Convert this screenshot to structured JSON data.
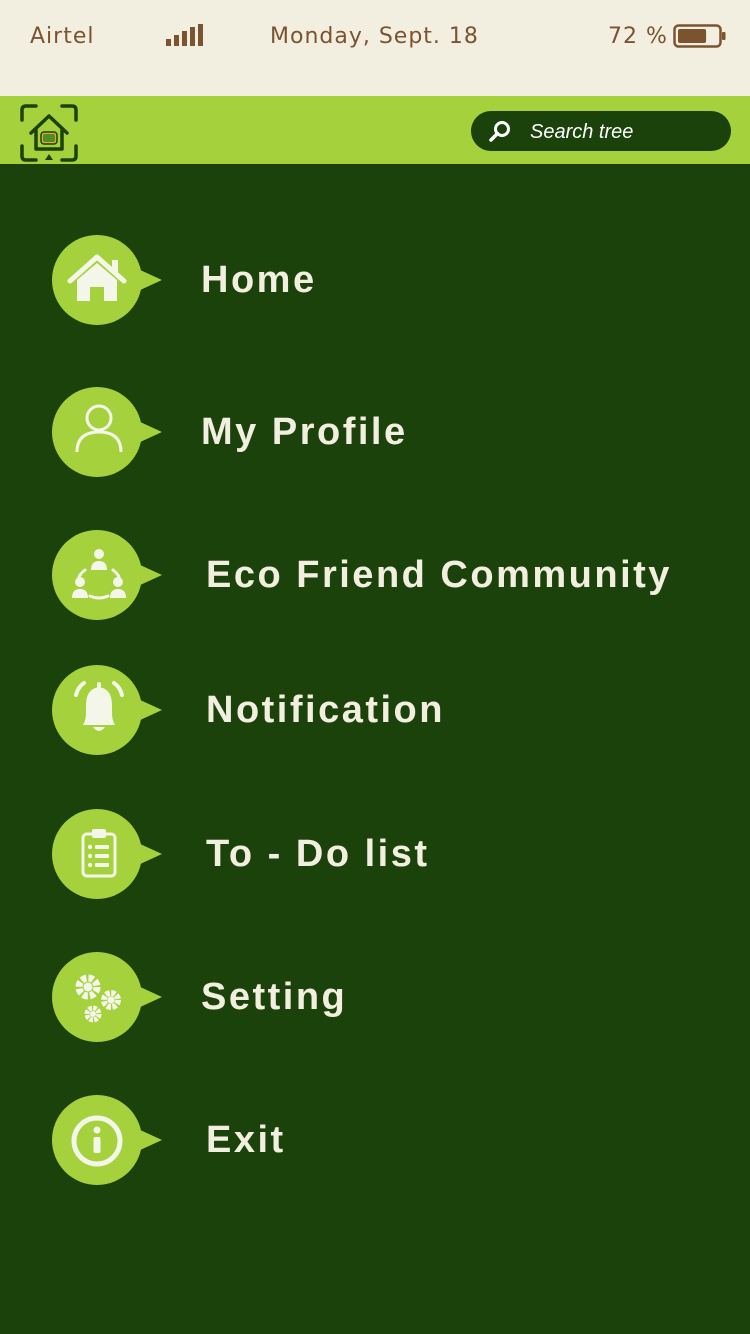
{
  "status_bar": {
    "carrier": "Airtel",
    "date": "Monday, Sept. 18",
    "battery": "72 %",
    "battery_level_percent": 72
  },
  "header": {
    "search": {
      "placeholder": "Search tree"
    }
  },
  "menu": {
    "items": [
      {
        "label": "Home",
        "icon": "home-icon"
      },
      {
        "label": "My Profile",
        "icon": "user-icon"
      },
      {
        "label": "Eco Friend Community",
        "icon": "community-icon"
      },
      {
        "label": "Notification",
        "icon": "bell-icon"
      },
      {
        "label": "To - Do list",
        "icon": "clipboard-icon"
      },
      {
        "label": "Setting",
        "icon": "gears-icon"
      },
      {
        "label": "Exit",
        "icon": "info-icon"
      }
    ]
  },
  "colors": {
    "background": "#1c420b",
    "accent": "#a5d23c",
    "status_bar": "#f2efe0",
    "status_text": "#7b5330",
    "menu_text": "#f2efe0"
  }
}
